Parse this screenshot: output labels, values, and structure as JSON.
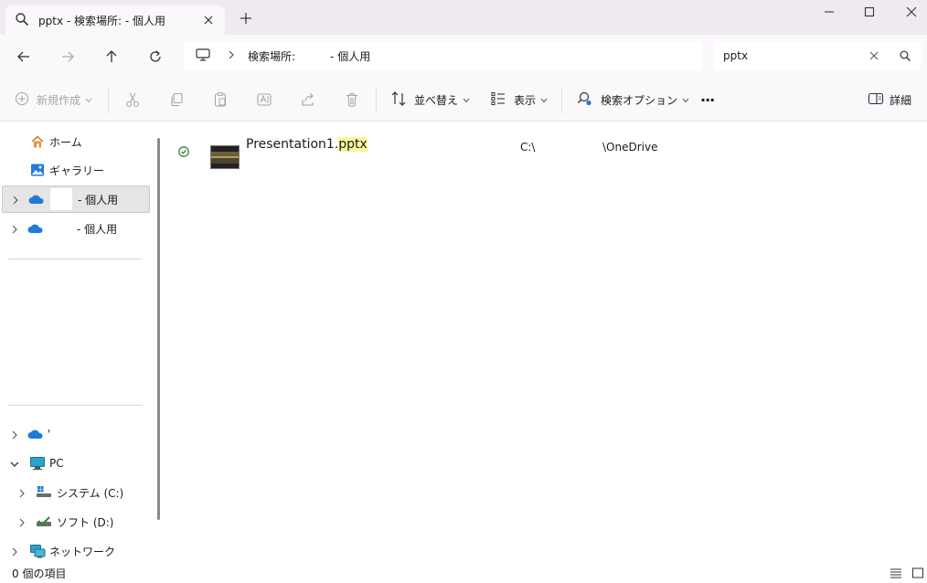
{
  "window": {
    "tab_title": "pptx - 検索場所:        - 個人用"
  },
  "nav": {
    "breadcrumb_root": "検索場所:",
    "breadcrumb_suffix": "- 個人用"
  },
  "search": {
    "value": "pptx"
  },
  "toolbar": {
    "new_label": "新規作成",
    "sort_label": "並べ替え",
    "view_label": "表示",
    "search_options_label": "検索オプション",
    "details_label": "詳細",
    "more": "···"
  },
  "sidebar": {
    "home": "ホーム",
    "gallery": "ギャラリー",
    "onedrive1_suffix": "- 個人用",
    "onedrive2_suffix": "- 個人用",
    "onedrive3_label": "'",
    "pc": "PC",
    "drive_c": "システム (C:)",
    "drive_d": "ソフト (D:)",
    "network": "ネットワーク"
  },
  "files": [
    {
      "name_prefix": "Presentation1.",
      "name_highlight": "pptx",
      "path1": "C:\\",
      "path2": "\\OneDrive"
    }
  ],
  "statusbar": {
    "count": "0 個の項目"
  },
  "colors": {
    "titlebar": "#f0e9f2",
    "chrome": "#fbf8fb",
    "highlight": "#fdf79c",
    "onedrive_blue": "#1f7bd7",
    "status_green": "#2e8b3f"
  }
}
